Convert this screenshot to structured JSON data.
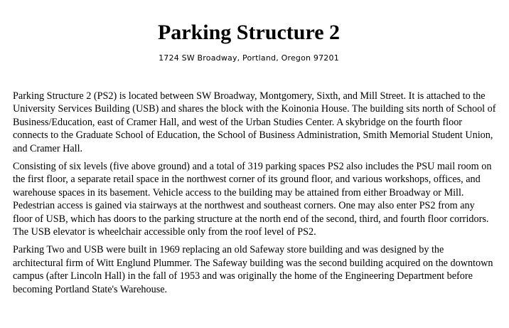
{
  "document": {
    "title": "Parking Structure 2",
    "address": "1724 SW Broadway, Portland, Oregon 97201",
    "paragraphs": [
      "Parking Structure 2 (PS2) is located between SW Broadway, Montgomery, Sixth, and Mill Street. It is attached to the University Services Building (USB) and shares the block with the Koinonia House. The building sits north of School of Business/Education, east of Cramer Hall, and west of the Urban Studies Center. A skybridge on the fourth floor connects to the Graduate School of Education, the School of Business Administration, Smith Memorial Student Union, and Cramer Hall.",
      "Consisting of six levels (five above ground) and a total of 319 parking spaces PS2 also includes the PSU mail room on the first floor, a separate retail space in the northwest corner of its ground floor, and various workshops, offices, and warehouse spaces in its basement. Vehicle access to the building may be attained from either Broadway or Mill. Pedestrian access is gained via stairways at the northwest and southeast corners. One may also enter PS2 from any floor of USB, which has doors to the parking structure at the north end of the second, third, and fourth floor corridors. The USB elevator is wheelchair accessible only from the roof level of PS2.",
      "Parking Two and USB were built in 1969 replacing an old Safeway store building and was designed by the architectural firm of Witt Englund Plummer. The Safeway building was the second building acquired on the downtown campus (after Lincoln Hall) in the fall of 1953 and was originally the home of the Engineering Department before becoming Portland State's Warehouse."
    ]
  }
}
